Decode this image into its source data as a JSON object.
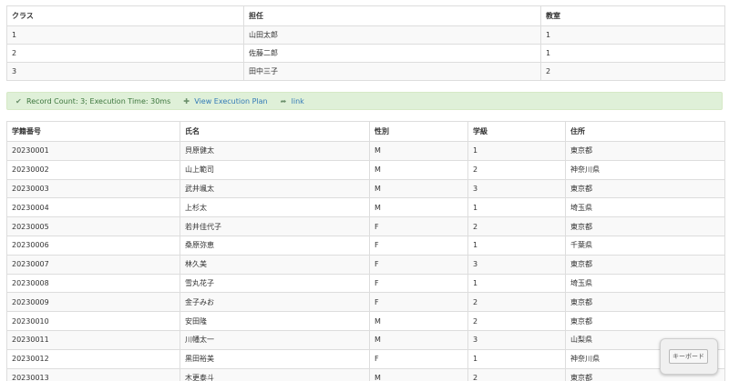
{
  "classes_table": {
    "columns": [
      "クラス",
      "担任",
      "教室"
    ],
    "rows": [
      [
        "1",
        "山田太郎",
        "1"
      ],
      [
        "2",
        "佐藤二郎",
        "1"
      ],
      [
        "3",
        "田中三子",
        "2"
      ]
    ]
  },
  "status_bar": {
    "record_text": "Record Count: 3; Execution Time: 30ms",
    "plan_link": "View Execution Plan",
    "link": "link",
    "icons": [
      "check-icon",
      "plus-icon",
      "share-arrow-icon"
    ],
    "background_color": "#dff0d8"
  },
  "students_table": {
    "columns": [
      "学籍番号",
      "氏名",
      "性別",
      "学級",
      "住所"
    ],
    "rows": [
      [
        "20230001",
        "貝原健太",
        "M",
        "1",
        "東京都"
      ],
      [
        "20230002",
        "山上範司",
        "M",
        "2",
        "神奈川県"
      ],
      [
        "20230003",
        "武井颯太",
        "M",
        "3",
        "東京都"
      ],
      [
        "20230004",
        "上杉太",
        "M",
        "1",
        "埼玉県"
      ],
      [
        "20230005",
        "若井佳代子",
        "F",
        "2",
        "東京都"
      ],
      [
        "20230006",
        "桑原弥恵",
        "F",
        "1",
        "千葉県"
      ],
      [
        "20230007",
        "林久美",
        "F",
        "3",
        "東京都"
      ],
      [
        "20230008",
        "雪丸花子",
        "F",
        "1",
        "埼玉県"
      ],
      [
        "20230009",
        "金子みお",
        "F",
        "2",
        "東京都"
      ],
      [
        "20230010",
        "安田隆",
        "M",
        "2",
        "東京都"
      ],
      [
        "20230011",
        "川幡太一",
        "M",
        "3",
        "山梨県"
      ],
      [
        "20230012",
        "黒田裕美",
        "F",
        "1",
        "神奈川県"
      ],
      [
        "20230013",
        "木更泰斗",
        "M",
        "2",
        "東京都"
      ]
    ]
  },
  "keyboard": {
    "label": "キーボード"
  }
}
